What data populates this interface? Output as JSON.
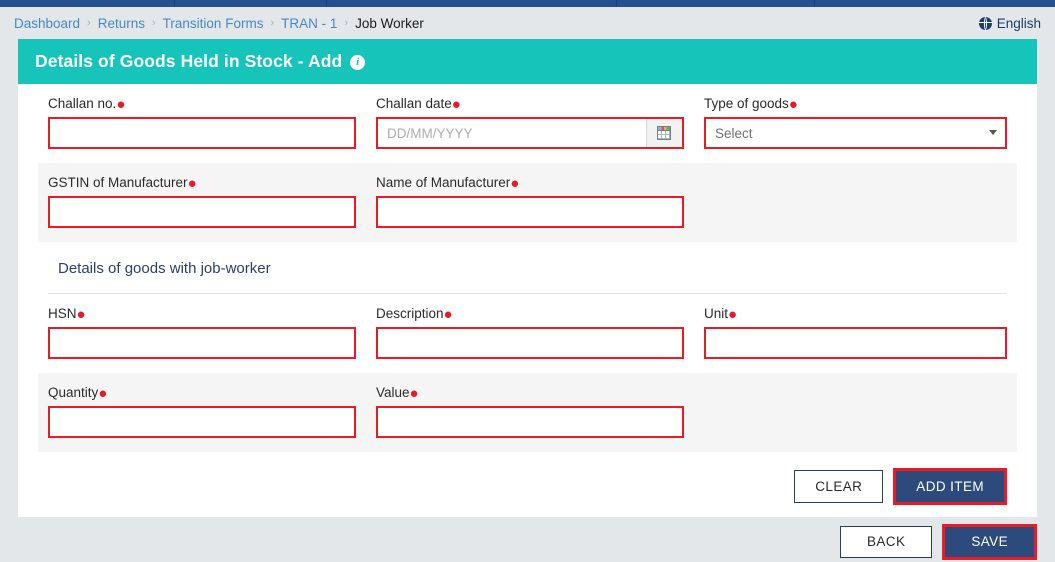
{
  "breadcrumb": {
    "separator": "›",
    "items": [
      {
        "label": "Dashboard",
        "current": false
      },
      {
        "label": "Returns",
        "current": false
      },
      {
        "label": "Transition Forms",
        "current": false
      },
      {
        "label": "TRAN - 1",
        "current": false
      },
      {
        "label": "Job Worker",
        "current": true
      }
    ]
  },
  "language": {
    "label": "English",
    "icon": "globe-icon"
  },
  "card": {
    "title": "Details of Goods Held in Stock - Add",
    "info_icon": "i"
  },
  "form": {
    "challan_no": {
      "label": "Challan no.",
      "required": true,
      "value": "",
      "placeholder": ""
    },
    "challan_date": {
      "label": "Challan date",
      "required": true,
      "value": "",
      "placeholder": "DD/MM/YYYY",
      "icon": "calendar-icon"
    },
    "type_of_goods": {
      "label": "Type of goods",
      "required": true,
      "value": "Select",
      "options": [
        "Select"
      ]
    },
    "gstin_of_manufacturer": {
      "label": "GSTIN of Manufacturer",
      "required": true,
      "value": "",
      "placeholder": ""
    },
    "name_of_manufacturer": {
      "label": "Name of Manufacturer",
      "required": true,
      "value": "",
      "placeholder": ""
    },
    "section_heading": "Details of goods with job-worker",
    "hsn": {
      "label": "HSN",
      "required": true,
      "value": "",
      "placeholder": ""
    },
    "description": {
      "label": "Description",
      "required": true,
      "value": "",
      "placeholder": ""
    },
    "unit": {
      "label": "Unit",
      "required": true,
      "value": "",
      "placeholder": ""
    },
    "quantity": {
      "label": "Quantity",
      "required": true,
      "value": "",
      "placeholder": ""
    },
    "value_field": {
      "label": "Value",
      "required": true,
      "value": "",
      "placeholder": ""
    }
  },
  "actions": {
    "clear": "CLEAR",
    "add_item": "ADD ITEM",
    "back": "BACK",
    "save": "SAVE"
  },
  "colors": {
    "teal_header": "#17c4ba",
    "required_red": "#ea1b25",
    "primary_navy": "#2c4b7c",
    "page_bg": "#e3e7ea",
    "link_blue": "#4788c7"
  }
}
